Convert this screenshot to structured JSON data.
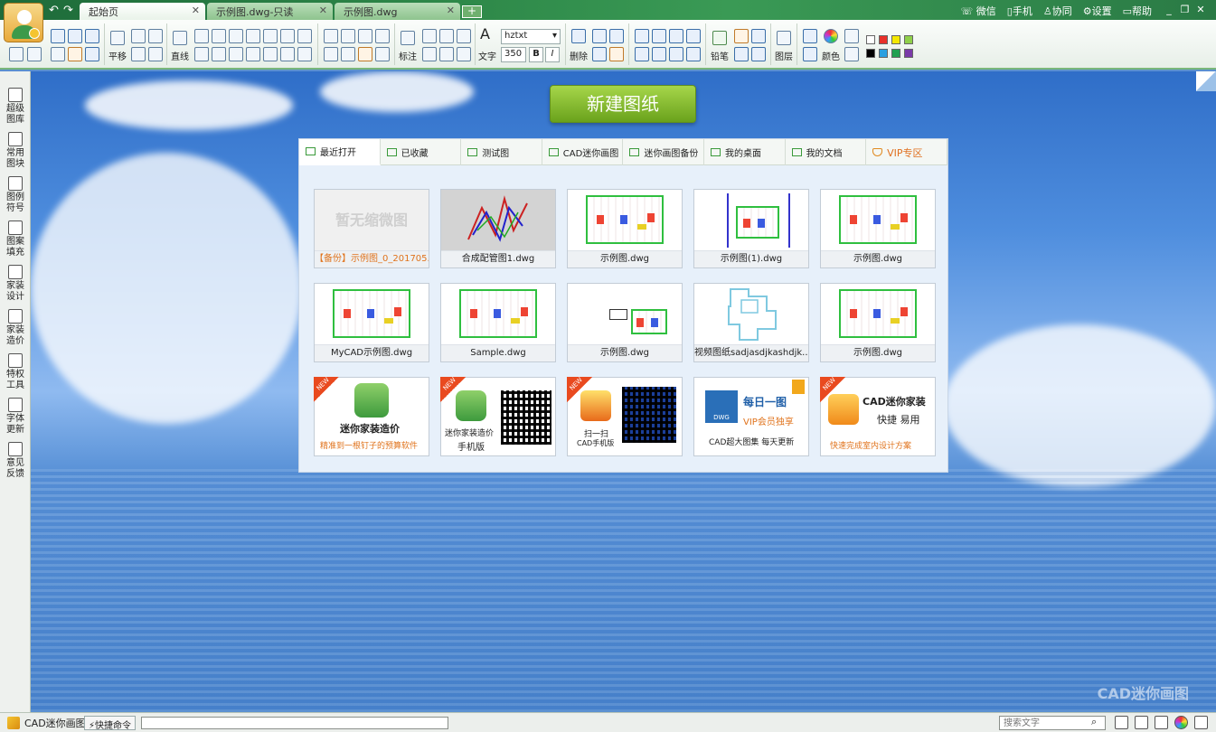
{
  "titlebar": {
    "tabs": [
      {
        "label": "起始页",
        "active": true
      },
      {
        "label": "示例图.dwg-只读",
        "active": false
      },
      {
        "label": "示例图.dwg",
        "active": false
      }
    ],
    "new_tab": "+",
    "right_links": [
      "微信",
      "手机",
      "协同",
      "设置",
      "帮助"
    ],
    "window_controls": [
      "_",
      "❐",
      "✕"
    ]
  },
  "ribbon": {
    "pan_label": "平移",
    "line_label": "直线",
    "dim_label": "标注",
    "text_label": "文字",
    "font_value": "hztxt",
    "size_value": "350",
    "bold": "B",
    "italic": "I",
    "delete_label": "删除",
    "pencil_label": "铅笔",
    "layer_label": "图层",
    "color_label": "颜色",
    "colors": [
      "#ffffff",
      "#e8312a",
      "#f4e800",
      "#8fd04a",
      "#000000",
      "#2aa0e0",
      "#20a050",
      "#7a3aa8"
    ]
  },
  "sidebar": {
    "items": [
      {
        "label1": "超级",
        "label2": "图库"
      },
      {
        "label1": "常用",
        "label2": "图块"
      },
      {
        "label1": "图例",
        "label2": "符号"
      },
      {
        "label1": "图案",
        "label2": "填充"
      },
      {
        "label1": "家装",
        "label2": "设计"
      },
      {
        "label1": "家装",
        "label2": "造价"
      },
      {
        "label1": "特权",
        "label2": "工具"
      },
      {
        "label1": "字体",
        "label2": "更新"
      },
      {
        "label1": "意见",
        "label2": "反馈"
      }
    ]
  },
  "main": {
    "new_drawing_label": "新建图纸",
    "panel_tabs": [
      "最近打开",
      "已收藏",
      "测试图",
      "CAD迷你画图",
      "迷你画图备份",
      "我的桌面",
      "我的文档",
      "VIP专区"
    ],
    "no_thumb_text": "暂无缩微图",
    "recent_files": [
      "【备份】示例图_0_201705...",
      "合成配管图1.dwg",
      "示例图.dwg",
      "示例图(1).dwg",
      "示例图.dwg",
      "MyCAD示例图.dwg",
      "Sample.dwg",
      "示例图.dwg",
      "视频图纸sadjasdjkashdjk...",
      "示例图.dwg"
    ],
    "promos": [
      {
        "title": "迷你家装造价",
        "subtitle": "精准到一根钉子的预算软件"
      },
      {
        "title": "迷你家装造价",
        "subtitle": "手机版"
      },
      {
        "title": "扫一扫",
        "subtitle": "CAD手机版"
      },
      {
        "title": "每日一图",
        "subtitle": "VIP会员独享",
        "extra": "CAD超大图集  每天更新",
        "logo": "DWG"
      },
      {
        "title": "CAD迷你家装",
        "subtitle": "快捷 易用",
        "extra": "快速完成室内设计方案"
      }
    ],
    "new_badge": "NEW",
    "watermark": "CAD迷你画图"
  },
  "statusbar": {
    "app_name": "CAD迷你画图",
    "quick_cmd": "快捷命令",
    "search_placeholder": "搜索文字"
  }
}
